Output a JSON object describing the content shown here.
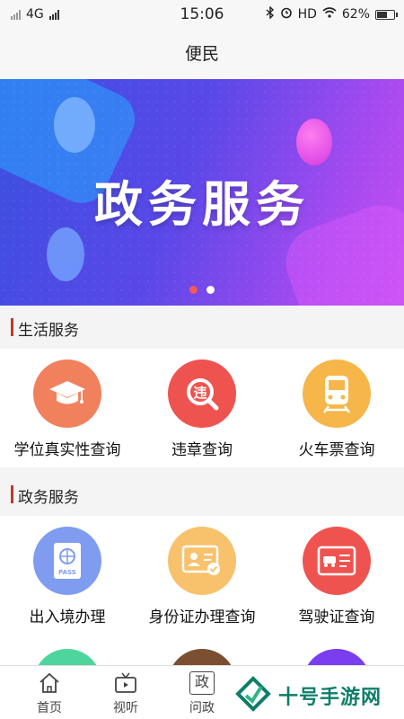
{
  "status_bar": {
    "network": "4G",
    "time": "15:06",
    "hd": "HD",
    "battery_percent": "62%",
    "battery_level": 0.62
  },
  "nav": {
    "title": "便民"
  },
  "banner": {
    "title": "政务服务",
    "pages": 2,
    "active_page": 0
  },
  "sections": [
    {
      "title": "生活服务",
      "items": [
        {
          "label": "学位真实性查询",
          "icon": "graduation-cap-icon",
          "color": "#f1805d"
        },
        {
          "label": "违章查询",
          "icon": "violation-search-icon",
          "color": "#ef5350"
        },
        {
          "label": "火车票查询",
          "icon": "train-icon",
          "color": "#f6b649"
        }
      ]
    },
    {
      "title": "政务服务",
      "items": [
        {
          "label": "出入境办理",
          "icon": "passport-icon",
          "color": "#7f9cf1"
        },
        {
          "label": "身份证办理查询",
          "icon": "id-card-icon",
          "color": "#f8c16c"
        },
        {
          "label": "驾驶证查询",
          "icon": "driver-license-icon",
          "color": "#ef5350"
        }
      ]
    }
  ],
  "partial_row_colors": [
    "#4ed59e",
    "#7a5030",
    "#7a3df0"
  ],
  "tabs": [
    {
      "label": "首页",
      "icon": "home-icon"
    },
    {
      "label": "视听",
      "icon": "tv-icon"
    },
    {
      "label": "问政",
      "icon": "zheng-icon",
      "glyph": "政"
    }
  ],
  "watermark": {
    "text": "十号手游网"
  }
}
